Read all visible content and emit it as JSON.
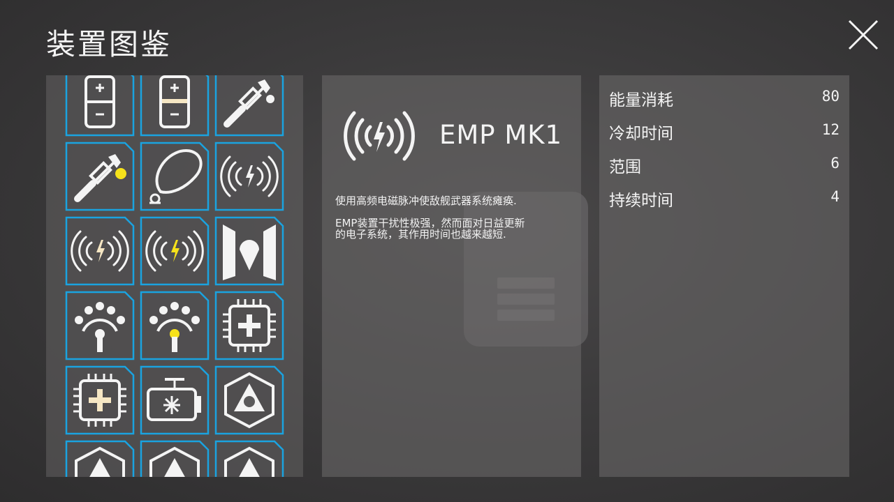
{
  "page": {
    "title": "装置图鉴"
  },
  "colors": {
    "slot_border": "#1aa3e0",
    "accent_yellow": "#f6e21a",
    "accent_cream": "#f6e7c4"
  },
  "grid": {
    "items": [
      {
        "name": "battery",
        "icon": "battery-icon",
        "variant": "white"
      },
      {
        "name": "battery-charged",
        "icon": "battery-icon",
        "variant": "cream"
      },
      {
        "name": "laser-torch",
        "icon": "laser-torch-icon",
        "variant": "white"
      },
      {
        "name": "laser-torch-yellow",
        "icon": "laser-torch-icon",
        "variant": "yellow"
      },
      {
        "name": "shield-bubble",
        "icon": "shield-bubble-icon",
        "variant": "white"
      },
      {
        "name": "emp",
        "icon": "emp-icon",
        "variant": "white"
      },
      {
        "name": "emp-cream",
        "icon": "emp-icon",
        "variant": "cream"
      },
      {
        "name": "emp-yellow",
        "icon": "emp-icon",
        "variant": "yellow"
      },
      {
        "name": "cloak-map",
        "icon": "cloak-icon",
        "variant": "white"
      },
      {
        "name": "sensor",
        "icon": "sensor-icon",
        "variant": "white"
      },
      {
        "name": "sensor-yellow",
        "icon": "sensor-icon",
        "variant": "yellow"
      },
      {
        "name": "repair-chip",
        "icon": "chip-plus-icon",
        "variant": "white"
      },
      {
        "name": "repair-chip-cream",
        "icon": "chip-plus-icon",
        "variant": "cream"
      },
      {
        "name": "cooler",
        "icon": "cooler-icon",
        "variant": "white"
      },
      {
        "name": "hex-drone",
        "icon": "hex-drone-icon",
        "variant": "white"
      },
      {
        "name": "hex-a",
        "icon": "hex-partial-icon",
        "variant": "white"
      },
      {
        "name": "hex-b",
        "icon": "hex-partial-icon",
        "variant": "white"
      },
      {
        "name": "hex-c",
        "icon": "hex-partial-icon",
        "variant": "white"
      }
    ]
  },
  "detail": {
    "icon": "emp-icon",
    "name": "EMP MK1",
    "description": "使用高频电磁脉冲使敌舰武器系统瘫痪.\n\nEMP装置干扰性极强，然而面对日益更新\n的电子系统，其作用时间也越来越短."
  },
  "stats": [
    {
      "label": "能量消耗",
      "value": "80"
    },
    {
      "label": "冷却时间",
      "value": "12"
    },
    {
      "label": "范围",
      "value": "6"
    },
    {
      "label": "持续时间",
      "value": "4"
    }
  ],
  "close": {
    "icon": "close-icon"
  }
}
